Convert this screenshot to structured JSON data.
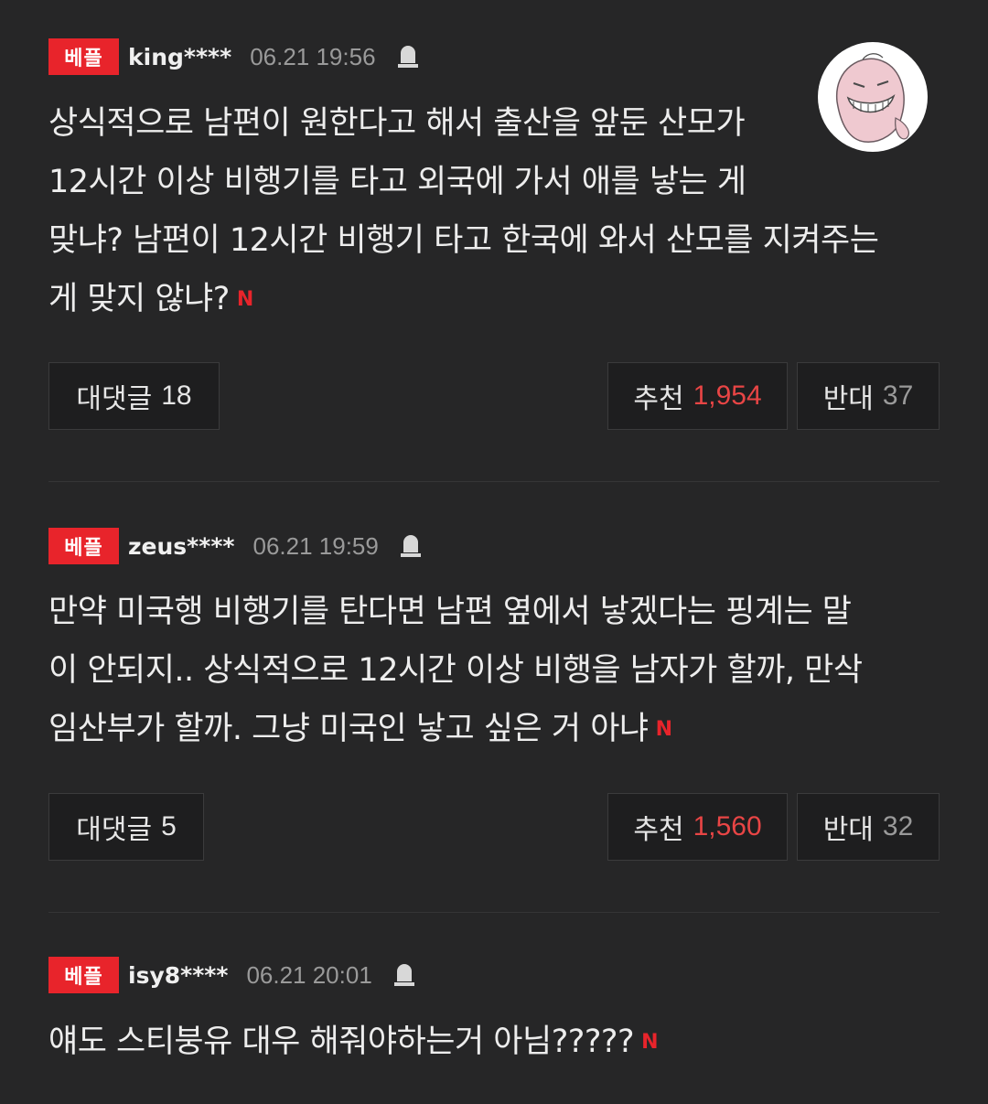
{
  "comments": [
    {
      "badge": "베플",
      "user": "king****",
      "time": "06.21 19:56",
      "lines": [
        "상식적으로 남편이 원한다고 해서 출산을 앞둔 산모가",
        "12시간 이상 비행기를 타고 외국에 가서 애를 낳는 게",
        "맞냐? 남편이 12시간 비행기 타고 한국에 와서 산모를 지켜주는",
        "게 맞지 않냐?"
      ],
      "new_mark": "N",
      "reply_label": "대댓글",
      "reply_count": "18",
      "like_label": "추천",
      "like_count": "1,954",
      "dislike_label": "반대",
      "dislike_count": "37"
    },
    {
      "badge": "베플",
      "user": "zeus****",
      "time": "06.21 19:59",
      "lines": [
        "만약 미국행 비행기를 탄다면 남편 옆에서 낳겠다는 핑계는 말",
        "이 안되지.. 상식적으로 12시간 이상 비행을 남자가 할까, 만삭",
        "임산부가 할까. 그냥 미국인 낳고 싶은 거 아냐"
      ],
      "new_mark": "N",
      "reply_label": "대댓글",
      "reply_count": "5",
      "like_label": "추천",
      "like_count": "1,560",
      "dislike_label": "반대",
      "dislike_count": "32"
    },
    {
      "badge": "베플",
      "user": "isy8****",
      "time": "06.21 20:01",
      "lines": [
        "얘도 스티붕유 대우 해줘야하는거 아님?????"
      ],
      "new_mark": "N"
    }
  ],
  "icons": {
    "report": "report-icon",
    "avatar": "laughing-character-avatar"
  },
  "colors": {
    "background": "#262627",
    "badge": "#e8242b",
    "like_count": "#e84545",
    "muted": "#9a9a9a"
  }
}
